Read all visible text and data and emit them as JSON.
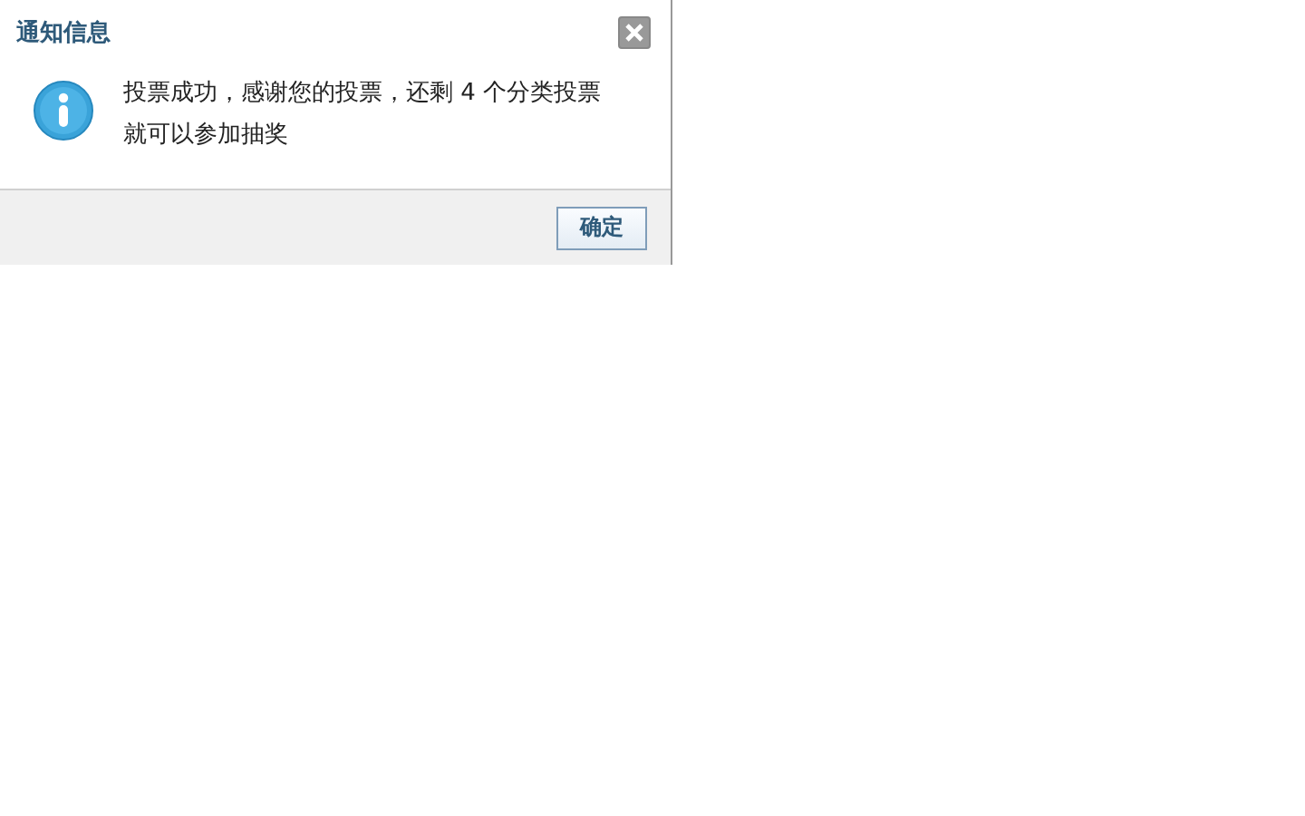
{
  "dialog": {
    "title": "通知信息",
    "message": "投票成功，感谢您的投票，还剩 4 个分类投票就可以参加抽奖",
    "buttons": [
      "确定"
    ]
  }
}
